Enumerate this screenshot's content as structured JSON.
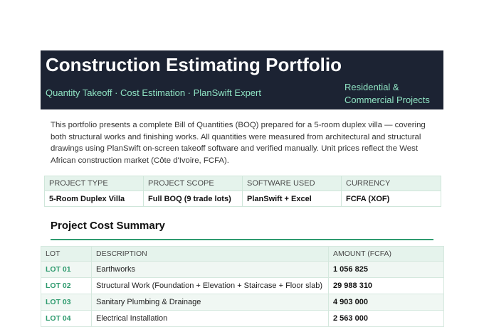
{
  "header": {
    "title": "Construction Estimating Portfolio",
    "tagline": "Quantity Takeoff · Cost Estimation · PlanSwift Expert",
    "scope_line1": "Residential &",
    "scope_line2": "Commercial Projects"
  },
  "intro": "This portfolio presents a complete Bill of Quantities (BOQ) prepared for a 5-room duplex villa — covering both structural works and finishing works. All quantities were measured from architectural and structural drawings using PlanSwift on-screen takeoff software and verified manually. Unit prices reflect the West African construction market (Côte d'Ivoire, FCFA).",
  "project_info": {
    "headers": [
      "PROJECT TYPE",
      "PROJECT SCOPE",
      "SOFTWARE USED",
      "CURRENCY"
    ],
    "values": [
      "5-Room Duplex Villa",
      "Full BOQ (9 trade lots)",
      "PlanSwift + Excel",
      "FCFA (XOF)"
    ]
  },
  "summary": {
    "title": "Project Cost Summary",
    "headers": [
      "LOT",
      "DESCRIPTION",
      "AMOUNT (FCFA)"
    ],
    "rows": [
      {
        "lot": "LOT 01",
        "description": "Earthworks",
        "amount": "1 056 825"
      },
      {
        "lot": "LOT 02",
        "description": "Structural Work (Foundation + Elevation + Staircase + Floor slab)",
        "amount": "29 988 310"
      },
      {
        "lot": "LOT 03",
        "description": "Sanitary Plumbing & Drainage",
        "amount": "4 903 000"
      },
      {
        "lot": "LOT 04",
        "description": "Electrical Installation",
        "amount": "2 563 000"
      }
    ]
  },
  "colors": {
    "banner_bg": "#1c2333",
    "accent_green": "#2f9b6f",
    "header_cell_bg": "#e5f3ec"
  }
}
